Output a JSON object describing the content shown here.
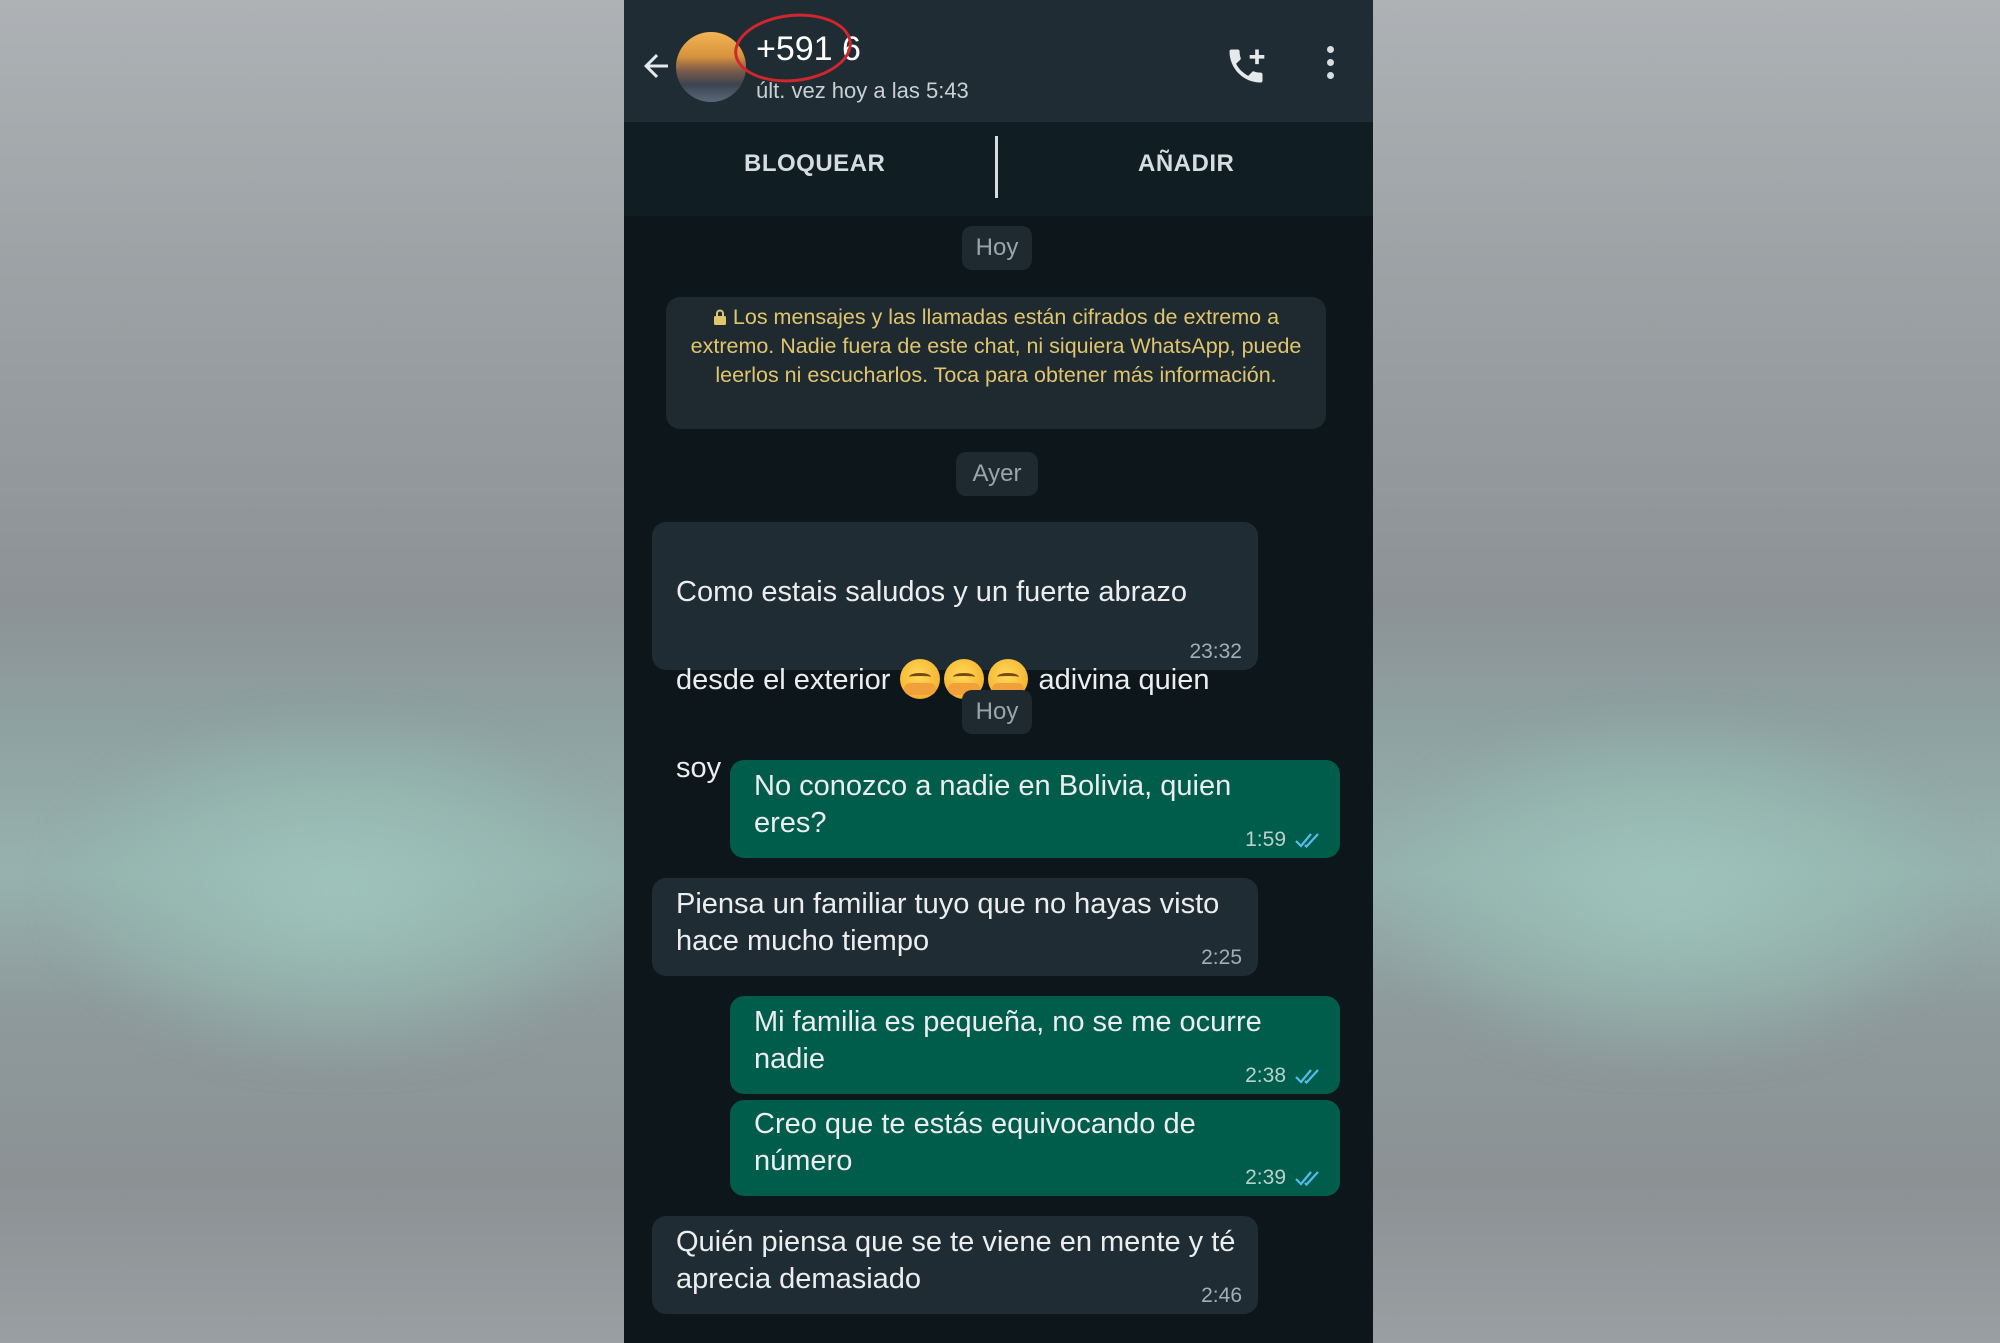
{
  "header": {
    "contact_name": "+591 6",
    "last_seen": "últ. vez hoy a las 5:43"
  },
  "actions": {
    "block_label": "BLOQUEAR",
    "add_label": "AÑADIR"
  },
  "chat": {
    "date_today_1": "Hoy",
    "encryption_notice": "Los mensajes y las llamadas están cifrados de extremo a extremo. Nadie fuera de este chat, ni siquiera WhatsApp, puede leerlos ni escucharlos. Toca para obtener más información.",
    "date_yesterday": "Ayer",
    "date_today_2": "Hoy",
    "messages": [
      {
        "direction": "in",
        "text_line1": "Como estais saludos y un fuerte abrazo",
        "text_line2_a": "desde el exterior",
        "text_line2_b": "adivina quien",
        "text_line3": "soy",
        "time": "23:32"
      },
      {
        "direction": "out",
        "text": "No conozco a nadie en Bolivia, quien\neres?",
        "time": "1:59"
      },
      {
        "direction": "in",
        "text": "Piensa un familiar tuyo que no hayas visto\nhace mucho tiempo",
        "time": "2:25"
      },
      {
        "direction": "out",
        "text": "Mi familia es pequeña, no se me ocurre\nnadie",
        "time": "2:38"
      },
      {
        "direction": "out",
        "text": "Creo que te estás equivocando de\nnúmero",
        "time": "2:39"
      },
      {
        "direction": "in",
        "text": "Quién piensa que se te viene en mente y té\naprecia demasiado",
        "time": "2:46"
      }
    ]
  },
  "colors": {
    "header_bg": "#1f2c34",
    "chat_bg": "#0d171b",
    "incoming_bubble": "#202c33",
    "outgoing_bubble": "#005c4b",
    "encryption_text": "#e0c56e",
    "annotation_circle": "#d1262c",
    "read_ticks": "#53bdeb"
  },
  "icons": {
    "back": "arrow-left-icon",
    "call": "add-call-icon",
    "menu": "more-vertical-icon",
    "lock": "lock-icon",
    "read": "double-check-icon"
  }
}
